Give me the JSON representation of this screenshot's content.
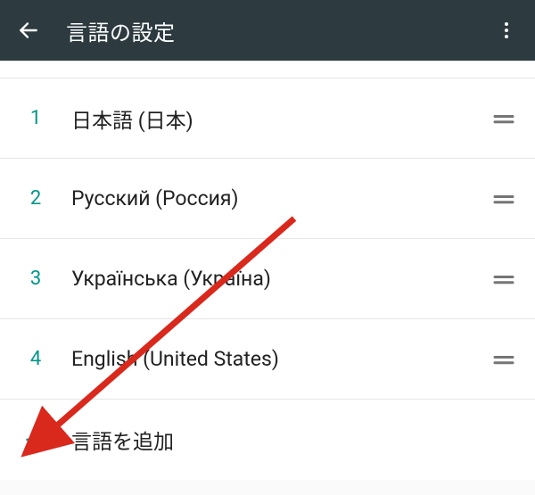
{
  "header": {
    "title": "言語の設定"
  },
  "languages": [
    {
      "index": "1",
      "label": "日本語 (日本)"
    },
    {
      "index": "2",
      "label": "Русский (Россия)"
    },
    {
      "index": "3",
      "label": "Українська (Україна)"
    },
    {
      "index": "4",
      "label": "English (United States)"
    }
  ],
  "add": {
    "label": "言語を追加"
  },
  "colors": {
    "accent": "#009688",
    "appbar": "#2d3b41",
    "annotation": "#d9281c"
  }
}
